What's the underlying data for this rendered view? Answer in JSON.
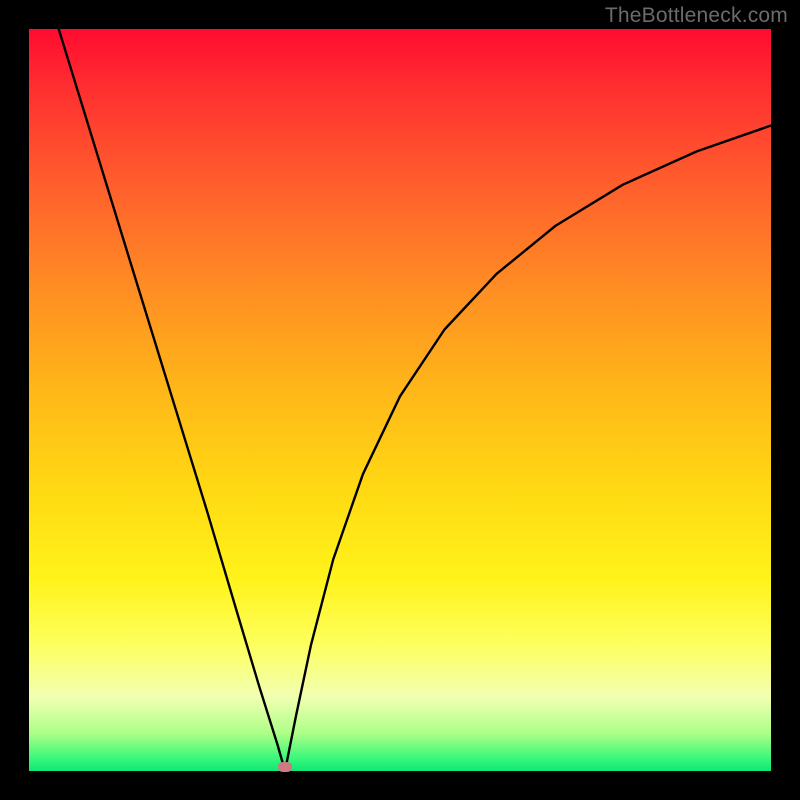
{
  "watermark": "TheBottleneck.com",
  "marker": {
    "x_fraction": 0.345,
    "y_fraction": 0.995
  },
  "colors": {
    "frame": "#000000",
    "curve": "#000000",
    "marker": "#cf7a80",
    "watermark": "#6b6b6b",
    "gradient_stops": [
      {
        "pos": 0.0,
        "hex": "#ff0b2f"
      },
      {
        "pos": 0.08,
        "hex": "#ff2f30"
      },
      {
        "pos": 0.2,
        "hex": "#ff5b2d"
      },
      {
        "pos": 0.34,
        "hex": "#ff8a24"
      },
      {
        "pos": 0.48,
        "hex": "#ffb519"
      },
      {
        "pos": 0.62,
        "hex": "#ffd913"
      },
      {
        "pos": 0.74,
        "hex": "#fff31a"
      },
      {
        "pos": 0.83,
        "hex": "#fdff5e"
      },
      {
        "pos": 0.9,
        "hex": "#f2ffb2"
      },
      {
        "pos": 0.95,
        "hex": "#abff87"
      },
      {
        "pos": 0.985,
        "hex": "#33f77a"
      },
      {
        "pos": 1.0,
        "hex": "#0fe876"
      }
    ]
  },
  "chart_data": {
    "type": "line",
    "title": "",
    "xlabel": "",
    "ylabel": "",
    "xlim": [
      0,
      1
    ],
    "ylim": [
      0,
      1
    ],
    "note": "V-shaped bottleneck curve. Left branch nearly linear descent; right branch steep near minimum then flattening toward top-right. Values are fractions of plot area (0 = left/top edge in screen terms for x; y given as height-from-bottom fraction).",
    "minimum_x": 0.345,
    "series": [
      {
        "name": "left-branch",
        "x": [
          0.04,
          0.08,
          0.12,
          0.16,
          0.2,
          0.24,
          0.28,
          0.31,
          0.335,
          0.345
        ],
        "y": [
          1.0,
          0.87,
          0.74,
          0.61,
          0.48,
          0.35,
          0.215,
          0.115,
          0.035,
          0.0
        ]
      },
      {
        "name": "right-branch",
        "x": [
          0.345,
          0.36,
          0.38,
          0.41,
          0.45,
          0.5,
          0.56,
          0.63,
          0.71,
          0.8,
          0.9,
          1.0
        ],
        "y": [
          0.0,
          0.075,
          0.17,
          0.285,
          0.4,
          0.505,
          0.595,
          0.67,
          0.735,
          0.79,
          0.835,
          0.87
        ]
      }
    ]
  }
}
